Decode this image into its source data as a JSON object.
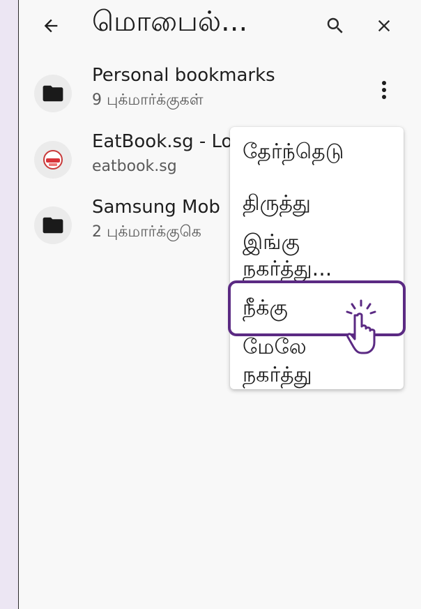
{
  "header": {
    "title": "மொபைல்...",
    "back_icon": "arrow-back-icon",
    "search_icon": "search-icon",
    "close_icon": "close-icon"
  },
  "items": [
    {
      "title": "Personal bookmarks",
      "subtitle": "9 புக்மார்க்குகள்",
      "icon": "folder-icon"
    },
    {
      "title": "EatBook.sg - Lo",
      "subtitle": "eatbook.sg",
      "icon": "site-favicon"
    },
    {
      "title": "Samsung Mob",
      "subtitle": "2 புக்மார்க்குகெ",
      "icon": "folder-icon"
    }
  ],
  "menu": {
    "select": "தேர்ந்தெடு",
    "edit": "திருத்து",
    "move_here_line1": "இங்கு",
    "move_here_line2": "நகர்த்து...",
    "remove": "நீக்கு",
    "move_up_line1": "மேலே",
    "move_up_line2": "நகர்த்து"
  },
  "colors": {
    "highlight": "#5b2a83",
    "background_frame": "#ece6f3"
  }
}
